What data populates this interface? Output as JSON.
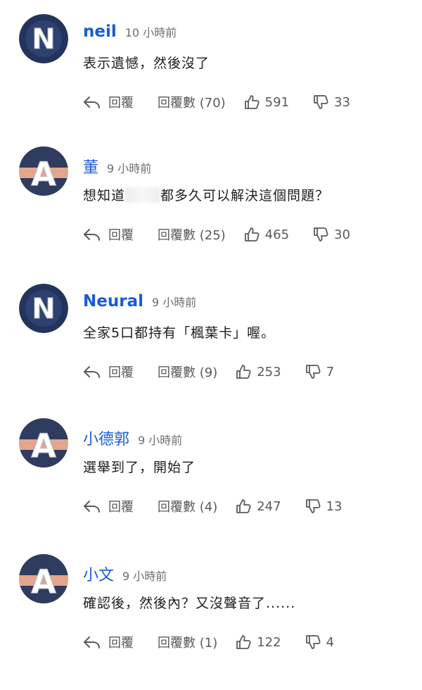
{
  "labels": {
    "reply": "回覆",
    "replies_prefix": "回覆數"
  },
  "comments": [
    {
      "avatar_letter": "N",
      "avatar_style": "navy",
      "username": "neil",
      "time": "10 小時前",
      "text": "表示遺憾，然後沒了",
      "replies": "回覆數 (70)",
      "likes": "591",
      "dislikes": "33"
    },
    {
      "avatar_letter": "A",
      "avatar_style": "striped",
      "username": "董",
      "time": "9 小時前",
      "text_before": "想知道",
      "text_after": "都多久可以解決這個問題？",
      "replies": "回覆數 (25)",
      "likes": "465",
      "dislikes": "30"
    },
    {
      "avatar_letter": "N",
      "avatar_style": "navy",
      "username": "Neural",
      "time": "9 小時前",
      "text": "全家5口都持有「楓葉卡」喔。",
      "replies": "回覆數 (9)",
      "likes": "253",
      "dislikes": "7"
    },
    {
      "avatar_letter": "A",
      "avatar_style": "striped",
      "username": "小德郭",
      "time": "9 小時前",
      "text": "選舉到了，開始了",
      "replies": "回覆數 (4)",
      "likes": "247",
      "dislikes": "13"
    },
    {
      "avatar_letter": "A",
      "avatar_style": "striped",
      "username": "小文",
      "time": "9 小時前",
      "text": "確認後，然後內？又沒聲音了......",
      "replies": "回覆數 (1)",
      "likes": "122",
      "dislikes": "4"
    }
  ],
  "colors": {
    "username": "#1a5bd6",
    "meta": "#6e6e73",
    "action": "#5a5a5e",
    "avatar_navy": "#23345c",
    "avatar_stripe_top": "#2f3b5f",
    "avatar_stripe_mid": "#e3a58b"
  }
}
